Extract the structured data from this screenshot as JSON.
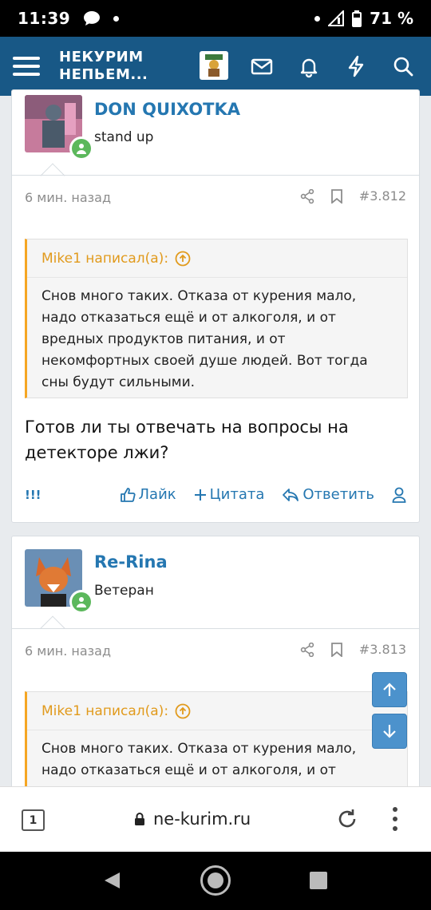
{
  "status_bar": {
    "time": "11:39",
    "battery": "71 %"
  },
  "app": {
    "brand_line1": "НЕКУРИМ",
    "brand_line2": "НЕПЬЕМ..."
  },
  "posts": [
    {
      "username": "DON QUIXOTKA",
      "user_title": "stand up",
      "time_ago": "6 мин. назад",
      "post_number": "#3.812",
      "quote_author": "Mike1 написал(а):",
      "quote_lines": [
        "Снов много таких. Отказа от курения мало,",
        "надо отказаться ещё и от алкоголя, и от",
        "вредных продуктов питания, и от",
        "некомфортных своей душе людей. Вот тогда",
        "сны будут сильными."
      ],
      "text_lines": [
        "Готов ли ты отвечать на вопросы на",
        "детекторе лжи?"
      ],
      "actions": {
        "flag": "!!!",
        "like": "Лайк",
        "quote": "Цитата",
        "reply": "Ответить"
      }
    },
    {
      "username": "Re-Rina",
      "user_title": "Ветеран",
      "time_ago": "6 мин. назад",
      "post_number": "#3.813",
      "quote_author": "Mike1 написал(а):",
      "quote_lines": [
        "Снов много таких. Отказа от курения мало,",
        "надо отказаться ещё и от алкоголя, и от"
      ]
    }
  ],
  "browser": {
    "tab_count": "1",
    "url": "ne-kurim.ru"
  },
  "colors": {
    "header": "#185886",
    "link": "#2577b1",
    "quote_accent": "#f5a623",
    "online": "#5cb85c"
  }
}
